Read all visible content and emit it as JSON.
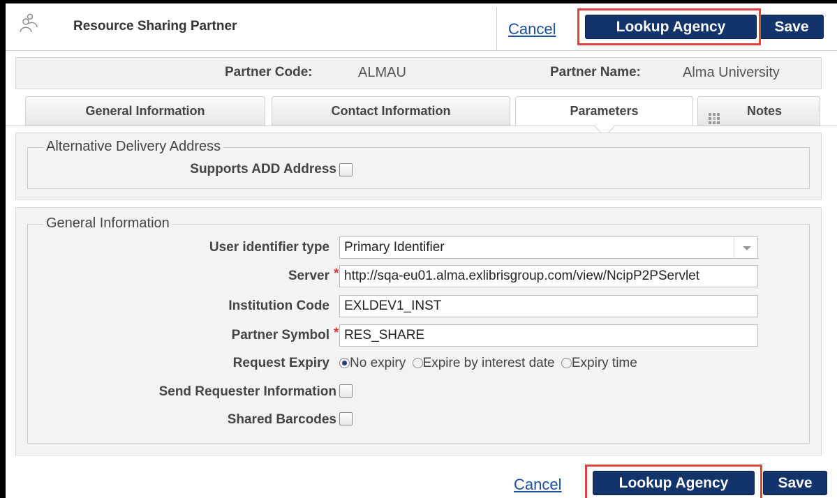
{
  "header": {
    "title": "Resource Sharing Partner",
    "cancel_label": "Cancel",
    "lookup_label": "Lookup Agency",
    "save_label": "Save"
  },
  "summary": {
    "code_label": "Partner Code:",
    "code_value": "ALMAU",
    "name_label": "Partner Name:",
    "name_value": "Alma University"
  },
  "tabs": [
    {
      "label": "General Information",
      "active": false
    },
    {
      "label": "Contact Information",
      "active": false
    },
    {
      "label": "Parameters",
      "active": true
    },
    {
      "label": "Notes",
      "active": false
    }
  ],
  "add_section": {
    "legend": "Alternative Delivery Address",
    "supports_label": "Supports ADD Address",
    "supports_checked": false
  },
  "general_section": {
    "legend": "General Information",
    "user_id_type_label": "User identifier type",
    "user_id_type_value": "Primary Identifier",
    "server_label": "Server",
    "server_value": "http://sqa-eu01.alma.exlibrisgroup.com/view/NcipP2PServlet",
    "institution_code_label": "Institution Code",
    "institution_code_value": "EXLDEV1_INST",
    "partner_symbol_label": "Partner Symbol",
    "partner_symbol_value": "RES_SHARE",
    "request_expiry_label": "Request Expiry",
    "expiry_options": [
      "No expiry",
      "Expire by interest date",
      "Expiry time"
    ],
    "expiry_selected": "No expiry",
    "send_requester_label": "Send Requester Information",
    "shared_barcodes_label": "Shared Barcodes",
    "required_mark": "*"
  },
  "footer": {
    "cancel_label": "Cancel",
    "lookup_label": "Lookup Agency",
    "save_label": "Save"
  },
  "colors": {
    "primary_button": "#13336b",
    "highlight": "#e0433f",
    "link": "#1a4fa0"
  }
}
